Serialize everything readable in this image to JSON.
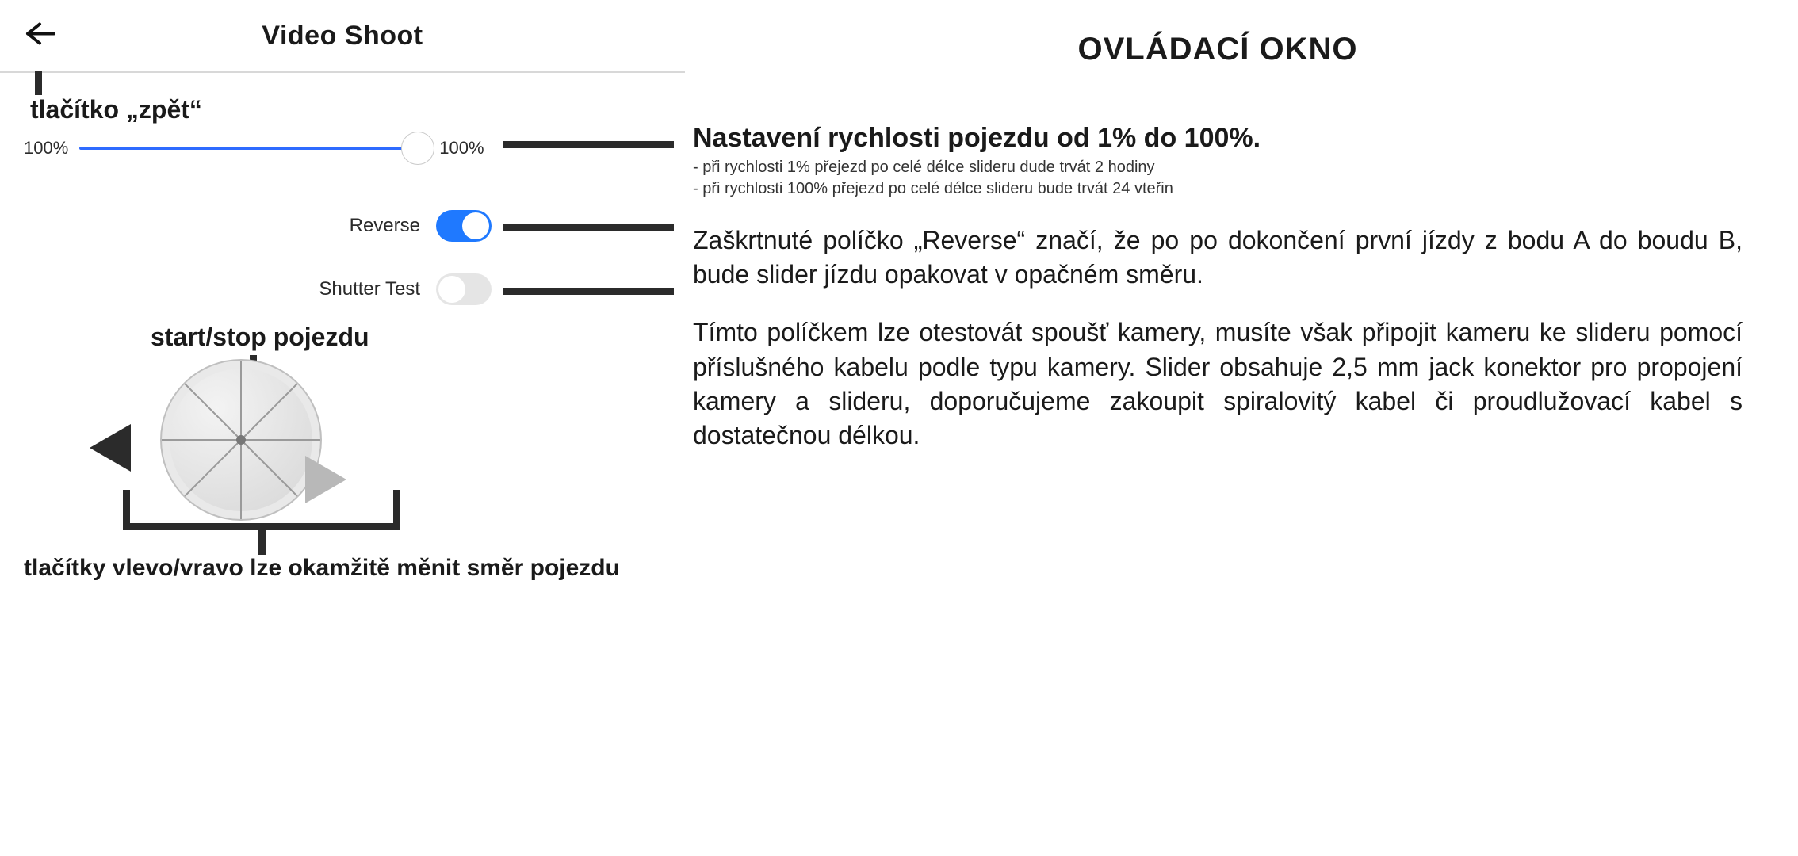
{
  "app": {
    "title": "Video Shoot",
    "slider": {
      "left_label": "100%",
      "value_label": "100%"
    },
    "reverse": {
      "label": "Reverse",
      "on": true
    },
    "shutter": {
      "label": "Shutter Test",
      "on": false
    }
  },
  "annotations": {
    "back": "tlačítko „zpět“",
    "start": "start/stop pojezdu",
    "bottom": "tlačítky vlevo/vravo lze okamžitě měnit směr pojezdu"
  },
  "right": {
    "title": "OVLÁDACÍ OKNO",
    "speed_heading": "Nastavení rychlosti pojezdu od 1% do 100%.",
    "speed_note1": "- při rychlosti 1% přejezd po celé délce slideru dude trvát 2 hodiny",
    "speed_note2": "- při rychlosti 100% přejezd po celé délce slideru bude trvát 24 vteřin",
    "reverse_para": "Zaškrtnuté políčko „Reverse“ značí, že po po dokončení první jízdy z bodu A do boudu B, bude slider jízdu opakovat v opačném směru.",
    "shutter_para": "Tímto políčkem lze otestovát spoušť kamery, musíte však připojit kameru ke slideru pomocí příslušného kabelu podle typu kamery. Slider obsahuje 2,5 mm jack konektor pro propojení kamery a slideru, doporučujeme zakoupit spiralovitý kabel či proudlužovací kabel s dostatečnou délkou."
  }
}
